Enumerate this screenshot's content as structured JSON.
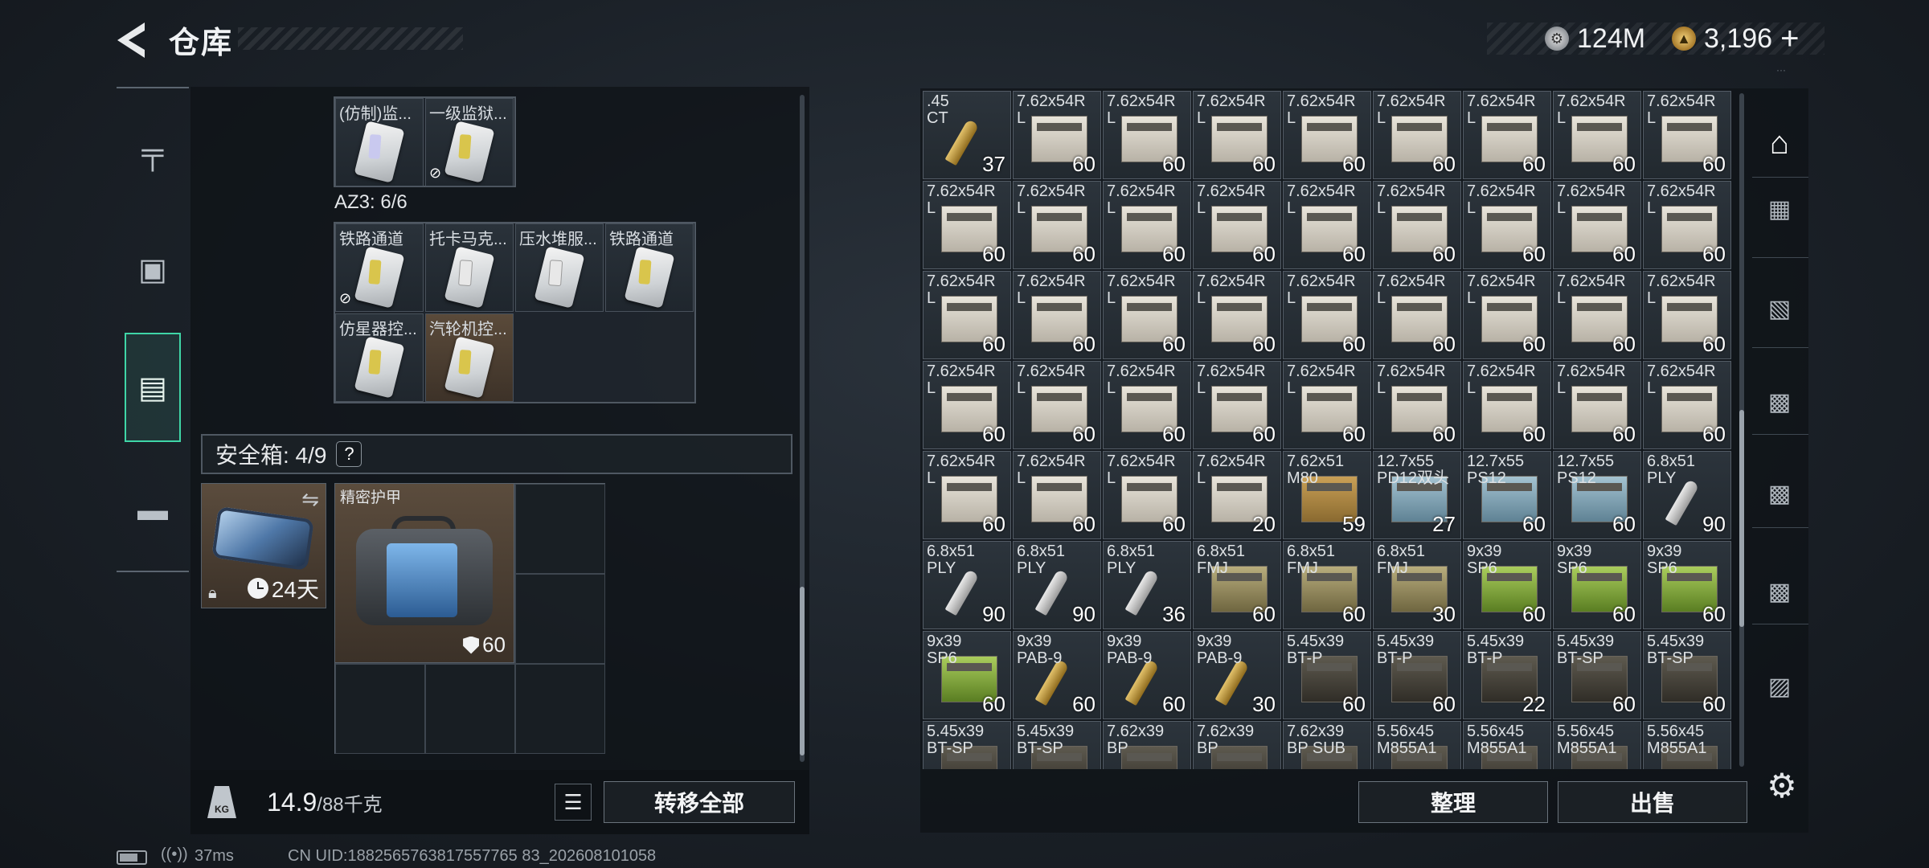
{
  "header": {
    "title": "仓库",
    "currency_silver": "124M",
    "currency_gold": "3,196",
    "plus": "+"
  },
  "left_rail": [
    {
      "icon": "gun-icon"
    },
    {
      "icon": "vest-icon"
    },
    {
      "icon": "backpack-icon",
      "active": true
    },
    {
      "icon": "briefcase-icon"
    }
  ],
  "container_top": {
    "cells": [
      {
        "label": "(仿制)监..."
      },
      {
        "label": "一级监狱..."
      }
    ]
  },
  "az3": {
    "label": "AZ3: 6/6",
    "cells": [
      {
        "label": "铁路通道"
      },
      {
        "label": "托卡马克..."
      },
      {
        "label": "压水堆服..."
      },
      {
        "label": "铁路通道"
      },
      {
        "label": "仿星器控..."
      },
      {
        "label": "汽轮机控..."
      }
    ]
  },
  "safe_box": {
    "label": "安全箱: 4/9",
    "help": "?",
    "timer": "24天",
    "armor_label": "精密护甲",
    "armor_durability": "60"
  },
  "footer_left": {
    "weight_current": "14.9",
    "weight_capacity": "/88千克",
    "transfer_all": "转移全部"
  },
  "stash": {
    "items": [
      {
        "l1": ".45",
        "l2": "CT",
        "count": "37",
        "kind": "bullet-brass"
      },
      {
        "l1": "7.62x54R",
        "l2": "L",
        "count": "60",
        "kind": "box"
      },
      {
        "l1": "7.62x54R",
        "l2": "L",
        "count": "60",
        "kind": "box"
      },
      {
        "l1": "7.62x54R",
        "l2": "L",
        "count": "60",
        "kind": "box"
      },
      {
        "l1": "7.62x54R",
        "l2": "L",
        "count": "60",
        "kind": "box"
      },
      {
        "l1": "7.62x54R",
        "l2": "L",
        "count": "60",
        "kind": "box"
      },
      {
        "l1": "7.62x54R",
        "l2": "L",
        "count": "60",
        "kind": "box"
      },
      {
        "l1": "7.62x54R",
        "l2": "L",
        "count": "60",
        "kind": "box"
      },
      {
        "l1": "7.62x54R",
        "l2": "L",
        "count": "60",
        "kind": "box"
      },
      {
        "l1": "7.62x54R",
        "l2": "L",
        "count": "60",
        "kind": "box"
      },
      {
        "l1": "7.62x54R",
        "l2": "L",
        "count": "60",
        "kind": "box"
      },
      {
        "l1": "7.62x54R",
        "l2": "L",
        "count": "60",
        "kind": "box"
      },
      {
        "l1": "7.62x54R",
        "l2": "L",
        "count": "60",
        "kind": "box"
      },
      {
        "l1": "7.62x54R",
        "l2": "L",
        "count": "60",
        "kind": "box"
      },
      {
        "l1": "7.62x54R",
        "l2": "L",
        "count": "60",
        "kind": "box"
      },
      {
        "l1": "7.62x54R",
        "l2": "L",
        "count": "60",
        "kind": "box"
      },
      {
        "l1": "7.62x54R",
        "l2": "L",
        "count": "60",
        "kind": "box"
      },
      {
        "l1": "7.62x54R",
        "l2": "L",
        "count": "60",
        "kind": "box"
      },
      {
        "l1": "7.62x54R",
        "l2": "L",
        "count": "60",
        "kind": "box"
      },
      {
        "l1": "7.62x54R",
        "l2": "L",
        "count": "60",
        "kind": "box"
      },
      {
        "l1": "7.62x54R",
        "l2": "L",
        "count": "60",
        "kind": "box"
      },
      {
        "l1": "7.62x54R",
        "l2": "L",
        "count": "60",
        "kind": "box"
      },
      {
        "l1": "7.62x54R",
        "l2": "L",
        "count": "60",
        "kind": "box"
      },
      {
        "l1": "7.62x54R",
        "l2": "L",
        "count": "60",
        "kind": "box"
      },
      {
        "l1": "7.62x54R",
        "l2": "L",
        "count": "60",
        "kind": "box"
      },
      {
        "l1": "7.62x54R",
        "l2": "L",
        "count": "60",
        "kind": "box"
      },
      {
        "l1": "7.62x54R",
        "l2": "L",
        "count": "60",
        "kind": "box"
      },
      {
        "l1": "7.62x54R",
        "l2": "L",
        "count": "60",
        "kind": "box"
      },
      {
        "l1": "7.62x54R",
        "l2": "L",
        "count": "60",
        "kind": "box"
      },
      {
        "l1": "7.62x54R",
        "l2": "L",
        "count": "60",
        "kind": "box"
      },
      {
        "l1": "7.62x54R",
        "l2": "L",
        "count": "60",
        "kind": "box"
      },
      {
        "l1": "7.62x54R",
        "l2": "L",
        "count": "60",
        "kind": "box"
      },
      {
        "l1": "7.62x54R",
        "l2": "L",
        "count": "60",
        "kind": "box"
      },
      {
        "l1": "7.62x54R",
        "l2": "L",
        "count": "60",
        "kind": "box"
      },
      {
        "l1": "7.62x54R",
        "l2": "L",
        "count": "60",
        "kind": "box"
      },
      {
        "l1": "7.62x54R",
        "l2": "L",
        "count": "60",
        "kind": "box"
      },
      {
        "l1": "7.62x54R",
        "l2": "L",
        "count": "60",
        "kind": "box"
      },
      {
        "l1": "7.62x54R",
        "l2": "L",
        "count": "60",
        "kind": "box"
      },
      {
        "l1": "7.62x54R",
        "l2": "L",
        "count": "60",
        "kind": "box"
      },
      {
        "l1": "7.62x54R",
        "l2": "L",
        "count": "20",
        "kind": "box"
      },
      {
        "l1": "7.62x51",
        "l2": "M80",
        "count": "59",
        "kind": "box-tan"
      },
      {
        "l1": "12.7x55",
        "l2": "PD12双头",
        "count": "27",
        "kind": "box-steel"
      },
      {
        "l1": "12.7x55",
        "l2": "PS12",
        "count": "60",
        "kind": "box-steel"
      },
      {
        "l1": "12.7x55",
        "l2": "PS12",
        "count": "60",
        "kind": "box-steel"
      },
      {
        "l1": "6.8x51",
        "l2": "PLY",
        "count": "90",
        "kind": "bullet"
      },
      {
        "l1": "6.8x51",
        "l2": "PLY",
        "count": "90",
        "kind": "bullet"
      },
      {
        "l1": "6.8x51",
        "l2": "PLY",
        "count": "90",
        "kind": "bullet"
      },
      {
        "l1": "6.8x51",
        "l2": "PLY",
        "count": "36",
        "kind": "bullet"
      },
      {
        "l1": "6.8x51",
        "l2": "FMJ",
        "count": "60",
        "kind": "box-olive"
      },
      {
        "l1": "6.8x51",
        "l2": "FMJ",
        "count": "60",
        "kind": "box-olive"
      },
      {
        "l1": "6.8x51",
        "l2": "FMJ",
        "count": "30",
        "kind": "box-olive"
      },
      {
        "l1": "9x39",
        "l2": "SP6",
        "count": "60",
        "kind": "box-green"
      },
      {
        "l1": "9x39",
        "l2": "SP6",
        "count": "60",
        "kind": "box-green"
      },
      {
        "l1": "9x39",
        "l2": "SP6",
        "count": "60",
        "kind": "box-green"
      },
      {
        "l1": "9x39",
        "l2": "SP6",
        "count": "60",
        "kind": "box-green"
      },
      {
        "l1": "9x39",
        "l2": "PAB-9",
        "count": "60",
        "kind": "bullet-brass"
      },
      {
        "l1": "9x39",
        "l2": "PAB-9",
        "count": "60",
        "kind": "bullet-brass"
      },
      {
        "l1": "9x39",
        "l2": "PAB-9",
        "count": "30",
        "kind": "bullet-brass"
      },
      {
        "l1": "5.45x39",
        "l2": "BT-P",
        "count": "60",
        "kind": "box-dark"
      },
      {
        "l1": "5.45x39",
        "l2": "BT-P",
        "count": "60",
        "kind": "box-dark"
      },
      {
        "l1": "5.45x39",
        "l2": "BT-P",
        "count": "22",
        "kind": "box-dark"
      },
      {
        "l1": "5.45x39",
        "l2": "BT-SP",
        "count": "60",
        "kind": "box-dark"
      },
      {
        "l1": "5.45x39",
        "l2": "BT-SP",
        "count": "60",
        "kind": "box-dark"
      },
      {
        "l1": "5.45x39",
        "l2": "BT-SP",
        "count": "",
        "kind": "box-dark"
      },
      {
        "l1": "5.45x39",
        "l2": "BT-SP",
        "count": "",
        "kind": "box-dark"
      },
      {
        "l1": "7.62x39",
        "l2": "BP",
        "count": "",
        "kind": "box-dark"
      },
      {
        "l1": "7.62x39",
        "l2": "BP",
        "count": "",
        "kind": "box-dark"
      },
      {
        "l1": "7.62x39",
        "l2": "BP SUB",
        "count": "",
        "kind": "box-dark"
      },
      {
        "l1": "5.56x45",
        "l2": "M855A1",
        "count": "",
        "kind": "box-dark"
      },
      {
        "l1": "5.56x45",
        "l2": "M855A1",
        "count": "",
        "kind": "box-dark"
      },
      {
        "l1": "5.56x45",
        "l2": "M855A1",
        "count": "",
        "kind": "box-dark"
      },
      {
        "l1": "5.56x45",
        "l2": "M855A1",
        "count": "",
        "kind": "box-dark"
      }
    ]
  },
  "footer_right": {
    "sort": "整理",
    "sell": "出售"
  },
  "status_bar": {
    "ping": "37ms",
    "uid": "CN UID:1882565763817557765 83_202608101058"
  }
}
